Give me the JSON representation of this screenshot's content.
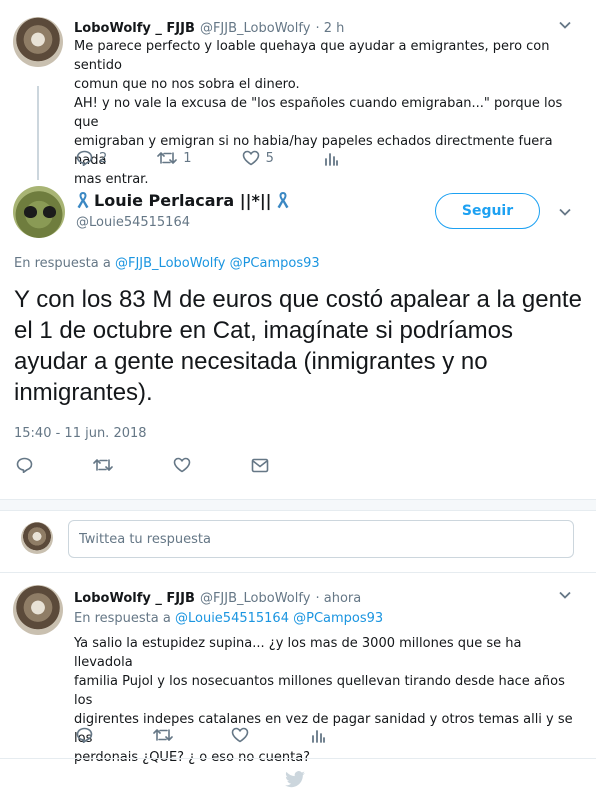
{
  "tweet1": {
    "name": "LoboWolfy _ FJJB",
    "handle": "@FJJB_LoboWolfy",
    "time": "· 2 h",
    "lines": [
      "Me parece perfecto y loable quehaya que ayudar a emigrantes, pero con sentido",
      "comun que no nos sobra el dinero.",
      "AH! y no vale la excusa de \"los españoles cuando emigraban...\" porque los que",
      "emigraban y emigran si no habia/hay papeles echados directmente fuera nada",
      "mas entrar."
    ],
    "replies": "2",
    "retweets": "1",
    "likes": "5"
  },
  "main_tweet": {
    "name": "Louie Perlacara ||*||",
    "handle": "@Louie54515164",
    "follow_label": "Seguir",
    "reply_prefix": "En respuesta a",
    "reply_to_1": "@FJJB_LoboWolfy",
    "reply_to_2": "@PCampos93",
    "text": "Y con los 83 M de euros que costó apalear a la gente el 1 de octubre en Cat, imagínate si podríamos ayudar a gente necesitada (inmigrantes y no inmigrantes).",
    "timestamp": "15:40 - 11 jun. 2018"
  },
  "compose": {
    "placeholder": "Twittea tu respuesta"
  },
  "tweet2": {
    "name": "LoboWolfy _ FJJB",
    "handle": "@FJJB_LoboWolfy",
    "time": "· ahora",
    "reply_prefix": "En respuesta a",
    "reply_to_1": "@Louie54515164",
    "reply_to_2": "@PCampos93",
    "lines": [
      "Ya salio la estupidez supina... ¿y los mas de 3000 millones que se ha llevadola",
      "familia Pujol y los nosecuantos millones quellevan tirando desde hace años los",
      "digirentes indepes catalanes en vez de pagar sanidad y otros temas alli y se los",
      "perdonais ¿QUE? ¿ o eso no cuenta?"
    ]
  },
  "colors": {
    "accent": "#1da1f2",
    "text": "#14171a",
    "muted": "#657786",
    "ribbon": "#3b88c3"
  }
}
